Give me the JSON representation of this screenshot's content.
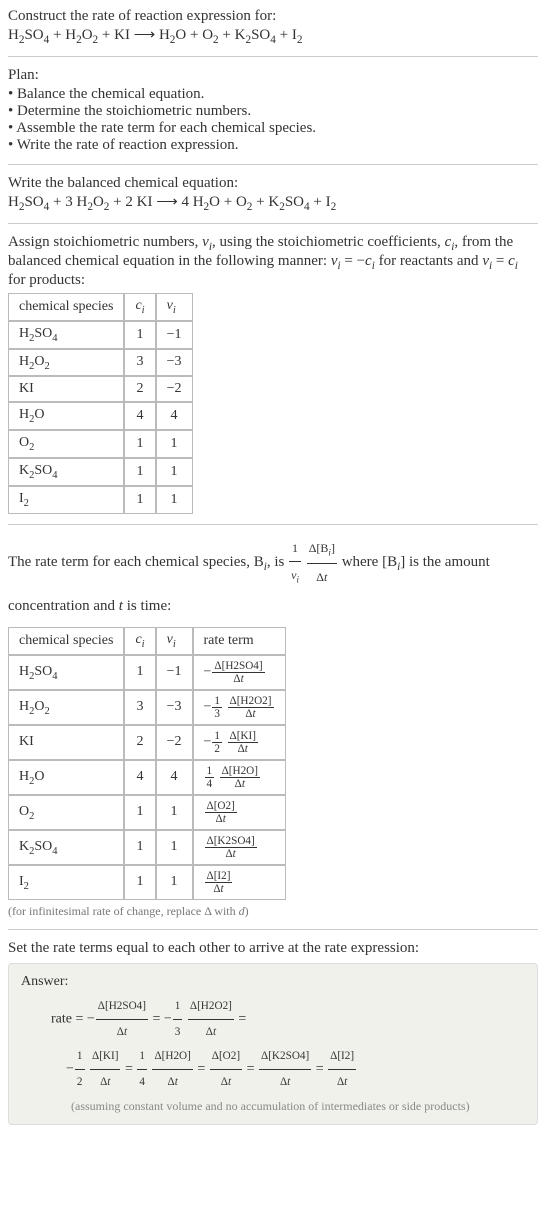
{
  "intro": {
    "construct": "Construct the rate of reaction expression for:",
    "equation_html": "H<span class='sub'>2</span>SO<span class='sub'>4</span> + H<span class='sub'>2</span>O<span class='sub'>2</span> + KI ⟶ H<span class='sub'>2</span>O + O<span class='sub'>2</span> + K<span class='sub'>2</span>SO<span class='sub'>4</span> + I<span class='sub'>2</span>"
  },
  "plan": {
    "title": "Plan:",
    "items": [
      "Balance the chemical equation.",
      "Determine the stoichiometric numbers.",
      "Assemble the rate term for each chemical species.",
      "Write the rate of reaction expression."
    ]
  },
  "balanced": {
    "title": "Write the balanced chemical equation:",
    "equation_html": "H<span class='sub'>2</span>SO<span class='sub'>4</span> + 3 H<span class='sub'>2</span>O<span class='sub'>2</span> + 2 KI ⟶ 4 H<span class='sub'>2</span>O + O<span class='sub'>2</span> + K<span class='sub'>2</span>SO<span class='sub'>4</span> + I<span class='sub'>2</span>"
  },
  "assign": {
    "text_html": "Assign stoichiometric numbers, <span class='ital'>ν<span class='sub'>i</span></span>, using the stoichiometric coefficients, <span class='ital'>c<span class='sub'>i</span></span>, from the balanced chemical equation in the following manner: <span class='ital'>ν<span class='sub'>i</span></span> = −<span class='ital'>c<span class='sub'>i</span></span> for reactants and <span class='ital'>ν<span class='sub'>i</span></span> = <span class='ital'>c<span class='sub'>i</span></span> for products:"
  },
  "table1": {
    "headers": {
      "species": "chemical species",
      "ci_html": "<span class='ital'>c<span class='sub'>i</span></span>",
      "vi_html": "<span class='ital'>ν<span class='sub'>i</span></span>"
    },
    "rows": [
      {
        "sp_html": "H<span class='sub'>2</span>SO<span class='sub'>4</span>",
        "ci": "1",
        "vi": "−1"
      },
      {
        "sp_html": "H<span class='sub'>2</span>O<span class='sub'>2</span>",
        "ci": "3",
        "vi": "−3"
      },
      {
        "sp_html": "KI",
        "ci": "2",
        "vi": "−2"
      },
      {
        "sp_html": "H<span class='sub'>2</span>O",
        "ci": "4",
        "vi": "4"
      },
      {
        "sp_html": "O<span class='sub'>2</span>",
        "ci": "1",
        "vi": "1"
      },
      {
        "sp_html": "K<span class='sub'>2</span>SO<span class='sub'>4</span>",
        "ci": "1",
        "vi": "1"
      },
      {
        "sp_html": "I<span class='sub'>2</span>",
        "ci": "1",
        "vi": "1"
      }
    ]
  },
  "rate_term_text": {
    "pre": "The rate term for each chemical species, B",
    "mid1": ", is ",
    "frac1_num_html": "1",
    "frac1_den_html": "<span class='ital'>ν<span class='sub'>i</span></span>",
    "frac2_num_html": "Δ[B<span class='sub ital'>i</span>]",
    "frac2_den_html": "Δ<span class='ital'>t</span>",
    "mid2": " where [B",
    "post_html": "] is the amount concentration and <span class='ital'>t</span> is time:"
  },
  "table2": {
    "headers": {
      "species": "chemical species",
      "ci_html": "<span class='ital'>c<span class='sub'>i</span></span>",
      "vi_html": "<span class='ital'>ν<span class='sub'>i</span></span>",
      "rate": "rate term"
    },
    "rows": [
      {
        "sp_html": "H<span class='sub'>2</span>SO<span class='sub'>4</span>",
        "ci": "1",
        "vi": "−1",
        "rate_html": "−<span class='frac'><span class='num'>Δ[H2SO4]</span><span class='den'>Δ<span class='ital'>t</span></span></span>"
      },
      {
        "sp_html": "H<span class='sub'>2</span>O<span class='sub'>2</span>",
        "ci": "3",
        "vi": "−3",
        "rate_html": "−<span class='frac'><span class='num'>1</span><span class='den'>3</span></span> <span class='frac'><span class='num'>Δ[H2O2]</span><span class='den'>Δ<span class='ital'>t</span></span></span>"
      },
      {
        "sp_html": "KI",
        "ci": "2",
        "vi": "−2",
        "rate_html": "−<span class='frac'><span class='num'>1</span><span class='den'>2</span></span> <span class='frac'><span class='num'>Δ[KI]</span><span class='den'>Δ<span class='ital'>t</span></span></span>"
      },
      {
        "sp_html": "H<span class='sub'>2</span>O",
        "ci": "4",
        "vi": "4",
        "rate_html": "<span class='frac'><span class='num'>1</span><span class='den'>4</span></span> <span class='frac'><span class='num'>Δ[H2O]</span><span class='den'>Δ<span class='ital'>t</span></span></span>"
      },
      {
        "sp_html": "O<span class='sub'>2</span>",
        "ci": "1",
        "vi": "1",
        "rate_html": "<span class='frac'><span class='num'>Δ[O2]</span><span class='den'>Δ<span class='ital'>t</span></span></span>"
      },
      {
        "sp_html": "K<span class='sub'>2</span>SO<span class='sub'>4</span>",
        "ci": "1",
        "vi": "1",
        "rate_html": "<span class='frac'><span class='num'>Δ[K2SO4]</span><span class='den'>Δ<span class='ital'>t</span></span></span>"
      },
      {
        "sp_html": "I<span class='sub'>2</span>",
        "ci": "1",
        "vi": "1",
        "rate_html": "<span class='frac'><span class='num'>Δ[I2]</span><span class='den'>Δ<span class='ital'>t</span></span></span>"
      }
    ]
  },
  "table2_note_html": "(for infinitesimal rate of change, replace Δ with <span class='ital'>d</span>)",
  "set_equal": "Set the rate terms equal to each other to arrive at the rate expression:",
  "answer": {
    "label": "Answer:",
    "line1_html": "rate = −<span class='frac'><span class='num'>Δ[H2SO4]</span><span class='den'>Δ<span class='ital'>t</span></span></span> = −<span class='frac'><span class='num'>1</span><span class='den'>3</span></span> <span class='frac'><span class='num'>Δ[H2O2]</span><span class='den'>Δ<span class='ital'>t</span></span></span> =",
    "line2_html": "−<span class='frac'><span class='num'>1</span><span class='den'>2</span></span> <span class='frac'><span class='num'>Δ[KI]</span><span class='den'>Δ<span class='ital'>t</span></span></span> = <span class='frac'><span class='num'>1</span><span class='den'>4</span></span> <span class='frac'><span class='num'>Δ[H2O]</span><span class='den'>Δ<span class='ital'>t</span></span></span> = <span class='frac'><span class='num'>Δ[O2]</span><span class='den'>Δ<span class='ital'>t</span></span></span> = <span class='frac'><span class='num'>Δ[K2SO4]</span><span class='den'>Δ<span class='ital'>t</span></span></span> = <span class='frac'><span class='num'>Δ[I2]</span><span class='den'>Δ<span class='ital'>t</span></span></span>",
    "note": "(assuming constant volume and no accumulation of intermediates or side products)"
  }
}
